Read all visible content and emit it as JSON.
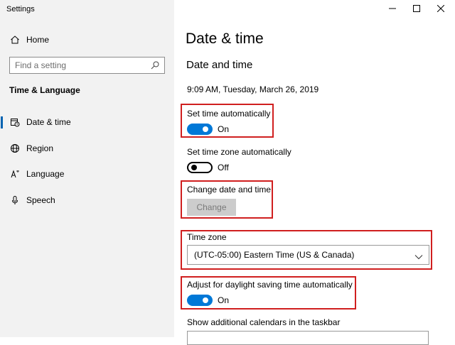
{
  "window": {
    "title": "Settings"
  },
  "sidebar": {
    "home_label": "Home",
    "search": {
      "placeholder": "Find a setting"
    },
    "section_heading": "Time & Language",
    "items": [
      {
        "label": "Date & time",
        "icon": "calendar-clock-icon",
        "active": true
      },
      {
        "label": "Region",
        "icon": "globe-icon",
        "active": false
      },
      {
        "label": "Language",
        "icon": "language-icon",
        "active": false
      },
      {
        "label": "Speech",
        "icon": "microphone-icon",
        "active": false
      }
    ]
  },
  "main": {
    "page_title": "Date & time",
    "subtitle": "Date and time",
    "current_datetime": "9:09 AM, Tuesday, March 26, 2019",
    "set_time_auto": {
      "label": "Set time automatically",
      "state": "On"
    },
    "set_timezone_auto": {
      "label": "Set time zone automatically",
      "state": "Off"
    },
    "change_date": {
      "label": "Change date and time",
      "button": "Change"
    },
    "time_zone": {
      "label": "Time zone",
      "value": "(UTC-05:00) Eastern Time (US & Canada)"
    },
    "dst": {
      "label": "Adjust for daylight saving time automatically",
      "state": "On"
    },
    "additional_calendars": {
      "label": "Show additional calendars in the taskbar"
    }
  },
  "colors": {
    "accent": "#0078d7",
    "highlight": "#d01f1f",
    "sidebar_bg": "#f2f2f2"
  }
}
